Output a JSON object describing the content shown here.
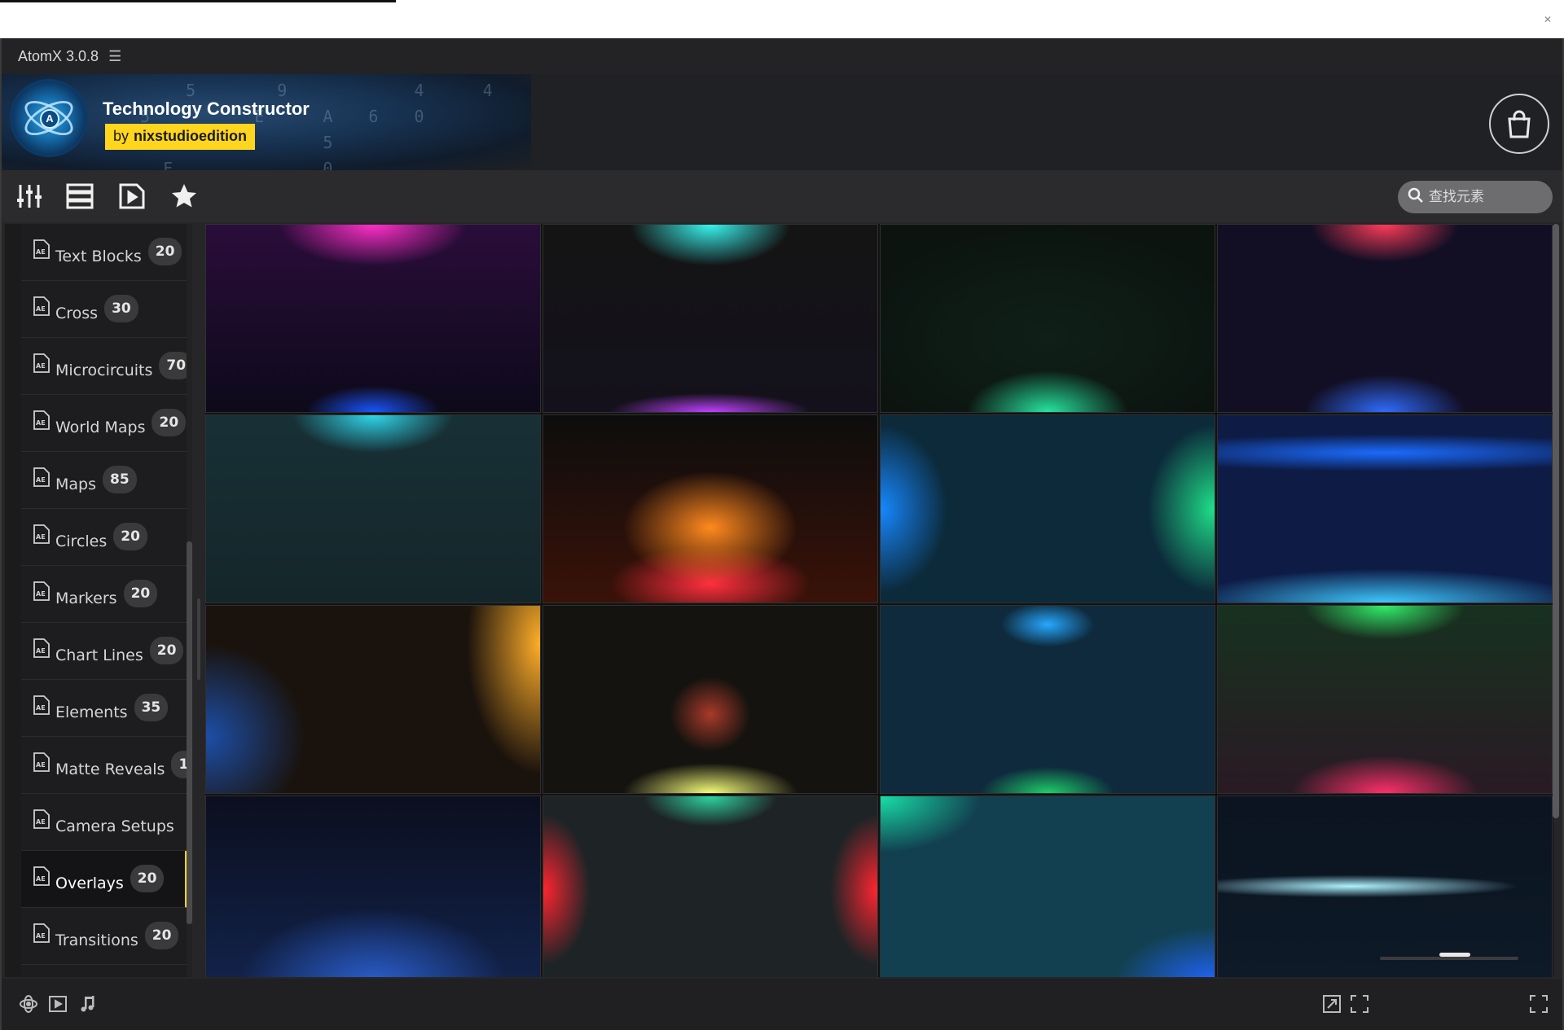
{
  "app": {
    "title": "AtomX 3.0.8",
    "menu_icon": "hamburger-icon"
  },
  "banner": {
    "pack_title": "Technology Constructor",
    "author_prefix": "by",
    "author": "nixstudioedition",
    "digits": "  5   9     4  4\n5    E  A 6 0\n    0   5\n F      0"
  },
  "toolbar": {
    "icons": [
      "mixer-icon",
      "list-view-icon",
      "media-file-icon",
      "star-icon"
    ],
    "search_placeholder": "查找元素"
  },
  "sidebar": {
    "items": [
      {
        "label": "Text Blocks",
        "count": "20",
        "active": false
      },
      {
        "label": "Cross",
        "count": "30",
        "active": false
      },
      {
        "label": "Microcircuits",
        "count": "70",
        "active": false
      },
      {
        "label": "World Maps",
        "count": "20",
        "active": false
      },
      {
        "label": "Maps",
        "count": "85",
        "active": false
      },
      {
        "label": "Circles",
        "count": "20",
        "active": false
      },
      {
        "label": "Markers",
        "count": "20",
        "active": false
      },
      {
        "label": "Chart Lines",
        "count": "20",
        "active": false
      },
      {
        "label": "Elements",
        "count": "35",
        "active": false
      },
      {
        "label": "Matte Reveals",
        "count": "1",
        "active": false
      },
      {
        "label": "Camera Setups",
        "count": "",
        "active": false
      },
      {
        "label": "Overlays",
        "count": "20",
        "active": true
      },
      {
        "label": "Transitions",
        "count": "20",
        "active": false
      }
    ]
  },
  "thumbnails": [
    {
      "name": "overlay-magenta-top",
      "colors": [
        "#ff2fc8",
        "#2a0d3a",
        "#1a55ff"
      ]
    },
    {
      "name": "overlay-cyan-top",
      "colors": [
        "#38f4ee",
        "#14111c",
        "#c040ff"
      ]
    },
    {
      "name": "overlay-green-bottom",
      "colors": [
        "#0c1410",
        "#0f2018",
        "#26e4a0"
      ]
    },
    {
      "name": "overlay-red-top-blue-bottom",
      "colors": [
        "#ff3b5a",
        "#120f24",
        "#2f6cff"
      ]
    },
    {
      "name": "overlay-teal-top",
      "colors": [
        "#2fd6ea",
        "#173036",
        "#15262a"
      ]
    },
    {
      "name": "overlay-orange-center",
      "colors": [
        "#ff8a1e",
        "#3a1208",
        "#ff2f3f"
      ]
    },
    {
      "name": "overlay-blue-green-sides",
      "colors": [
        "#1688ff",
        "#0c2a3a",
        "#1fe08a"
      ]
    },
    {
      "name": "overlay-blue-lines",
      "colors": [
        "#1b6bff",
        "#0d1b45",
        "#3fc8ff"
      ]
    },
    {
      "name": "overlay-amber-right",
      "colors": [
        "#ffae2a",
        "#1a120c",
        "#1d4fa8"
      ]
    },
    {
      "name": "overlay-yellow-bottom",
      "colors": [
        "#f7ff7a",
        "#15130f",
        "#a83a2a"
      ]
    },
    {
      "name": "overlay-blue-green-center",
      "colors": [
        "#26a8ff",
        "#0e2a3c",
        "#1ecf6a"
      ]
    },
    {
      "name": "overlay-green-red",
      "colors": [
        "#33ee6a",
        "#17311f",
        "#ff2f6a"
      ]
    },
    {
      "name": "overlay-dark-blue",
      "colors": [
        "#12224a",
        "#0b0f1f",
        "#2a5ecc"
      ]
    },
    {
      "name": "overlay-red-sides",
      "colors": [
        "#2fd6a0",
        "#1e2426",
        "#ff2530"
      ]
    },
    {
      "name": "overlay-teal-wash",
      "colors": [
        "#17e0a8",
        "#124050",
        "#2066ff"
      ]
    },
    {
      "name": "overlay-light-streak",
      "colors": [
        "#0b1420",
        "#0e1a28",
        "#aef2ff"
      ]
    }
  ],
  "footer": {
    "icons": [
      "view-3d-icon",
      "video-icon",
      "music-icon",
      "fit-icon",
      "fullscreen-icon",
      "expand-icon"
    ],
    "zoom_level": 0.55
  }
}
